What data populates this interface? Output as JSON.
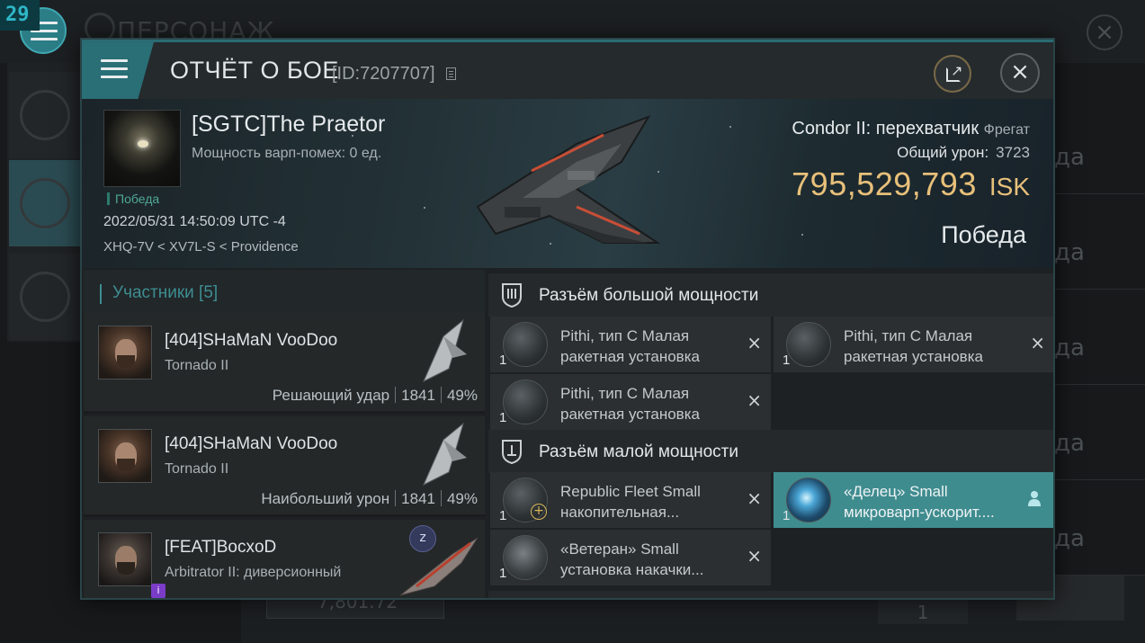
{
  "background": {
    "level": "29",
    "title": "ПЕРСОНАЖ",
    "row_label": "да",
    "bottom_value": "7,801.72",
    "bottom_page": "1"
  },
  "dialog": {
    "title": "ОТЧЁТ О БОЕ",
    "report_id": "[ID:7207707]",
    "icons": [
      "menu-icon",
      "copy-icon",
      "share-icon",
      "close-icon"
    ]
  },
  "victim": {
    "pilot": "[SGTC]The Praetor",
    "warp_strength": "Мощность варп-помех: 0 ед.",
    "status_tag": "Победа",
    "datetime": "2022/05/31 14:50:09 UTC -4",
    "location": "XHQ-7V < XV7L-S < Providence",
    "ship": "Condor II: перехватчик",
    "ship_class": "Фрегат",
    "damage_label": "Общий урон:",
    "damage_value": "3723",
    "isk_value": "795,529,793",
    "isk_unit": "ISK",
    "result": "Победа"
  },
  "participants": {
    "header": "Участники [5]",
    "rows": [
      {
        "name": "[404]SHaMaN VooDoo",
        "ship": "Tornado II",
        "role": "Решающий удар",
        "damage": "1841",
        "percent": "49%"
      },
      {
        "name": "[404]SHaMaN VooDoo",
        "ship": "Tornado II",
        "role": "Наибольший урон",
        "damage": "1841",
        "percent": "49%"
      },
      {
        "name": "[FEAT]BocxoD",
        "ship": "Arbitrator II: диверсионный",
        "badge": "z",
        "mini_badge": "i"
      }
    ]
  },
  "fittings": {
    "high_slots": {
      "title": "Разъём большой мощности",
      "modules": [
        {
          "line1": "Pithi, тип C Малая",
          "line2": "ракетная установка",
          "qty": "1",
          "action": "×"
        },
        {
          "line1": "Pithi, тип C Малая",
          "line2": "ракетная установка",
          "qty": "1",
          "action": "×"
        },
        {
          "line1": "Pithi, тип C Малая",
          "line2": "ракетная установка",
          "qty": "1",
          "action": "×"
        }
      ]
    },
    "low_slots": {
      "title": "Разъём малой мощности",
      "modules": [
        {
          "line1": "Republic Fleet Small",
          "line2": "накопительная...",
          "qty": "1",
          "action": "×"
        },
        {
          "line1": "«Делец» Small",
          "line2": "микроварп-ускорит....",
          "qty": "1",
          "action": "pilot-icon"
        },
        {
          "line1": "«Ветеран» Small",
          "line2": "установка накачки...",
          "qty": "1",
          "action": "×"
        }
      ]
    }
  }
}
